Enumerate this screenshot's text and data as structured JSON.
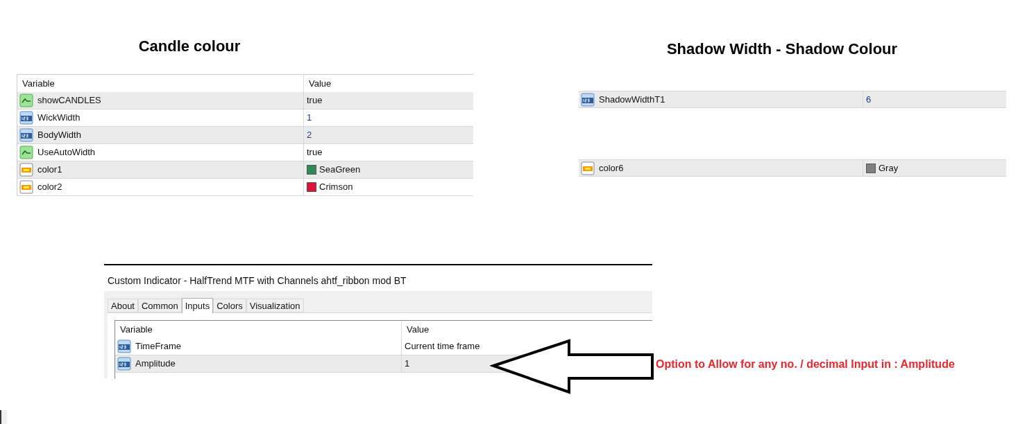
{
  "panels": [
    {
      "title": "Candle colour",
      "columns": [
        "Variable",
        "Value"
      ],
      "rows": [
        {
          "kind": "bool",
          "variable": "showCANDLES",
          "value": "true"
        },
        {
          "kind": "int",
          "variable": "WickWidth",
          "value": "1"
        },
        {
          "kind": "int",
          "variable": "BodyWidth",
          "value": "2"
        },
        {
          "kind": "bool",
          "variable": "UseAutoWidth",
          "value": "true"
        },
        {
          "kind": "color",
          "variable": "color1",
          "value": "SeaGreen",
          "color": "#2e8b57"
        },
        {
          "kind": "color",
          "variable": "color2",
          "value": "Crimson",
          "color": "#dc143c"
        }
      ]
    },
    {
      "title": "Shadow Width - Shadow Colour",
      "rows": [
        {
          "kind": "int",
          "variable": "ShadowWidthT1",
          "value": "6"
        },
        {
          "kind": "color",
          "variable": "color6",
          "value": "Gray",
          "color": "#808080"
        }
      ]
    }
  ],
  "dialog": {
    "title": "Custom Indicator - HalfTrend MTF with Channels ahtf_ribbon mod  BT",
    "tabs": [
      {
        "label": "About",
        "selected": false
      },
      {
        "label": "Common",
        "selected": false
      },
      {
        "label": "Inputs",
        "selected": true
      },
      {
        "label": "Colors",
        "selected": false
      },
      {
        "label": "Visualization",
        "selected": false
      }
    ],
    "columns": [
      "Variable",
      "Value"
    ],
    "rows": [
      {
        "kind": "int",
        "variable": "TimeFrame",
        "value": "Current time frame"
      },
      {
        "kind": "int",
        "variable": "Amplitude",
        "value": "1"
      }
    ]
  },
  "annotation": "Option to Allow for any no. / decimal Input in : Amplitude"
}
